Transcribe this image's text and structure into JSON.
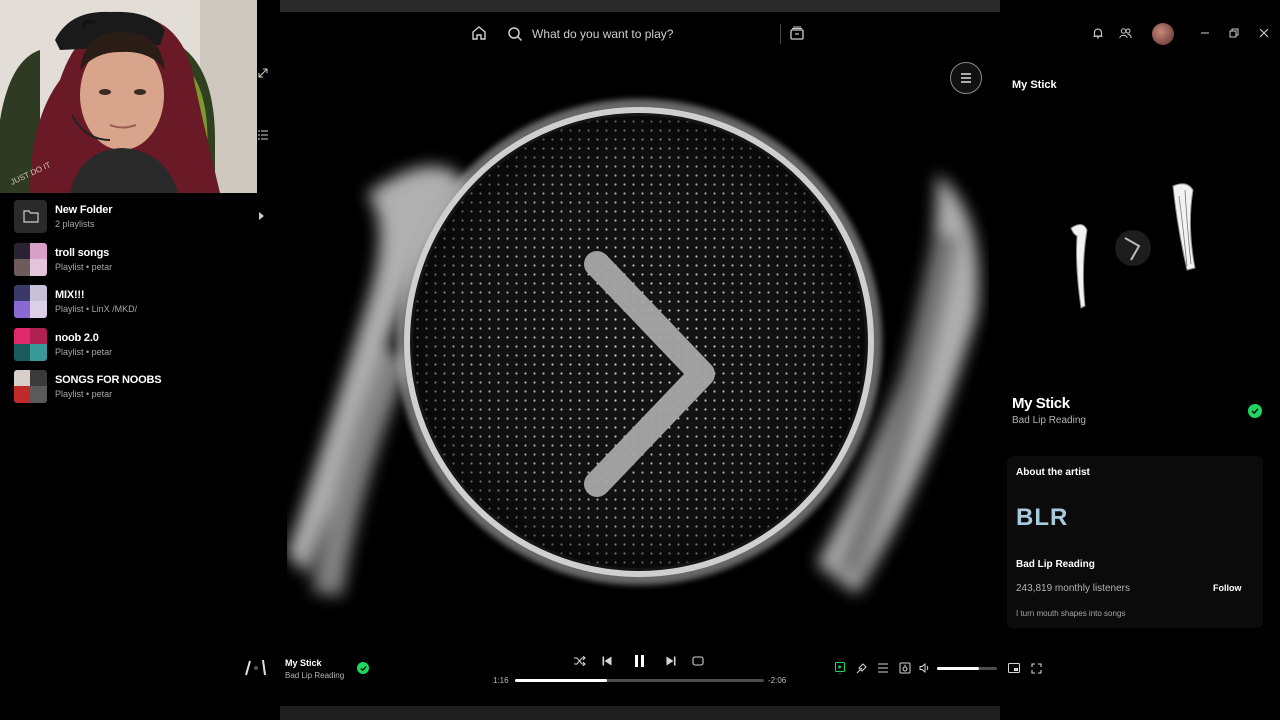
{
  "search": {
    "placeholder": "What do you want to play?"
  },
  "colors": {
    "accent": "#1ed760",
    "background": "#000000",
    "artist_logo": "#a9c9dc"
  },
  "library": {
    "items": [
      {
        "title": "New Folder",
        "subtitle": "2 playlists",
        "type": "folder",
        "icon": "folder-icon"
      },
      {
        "title": "troll songs",
        "subtitle": "Playlist • petar",
        "type": "playlist",
        "thumb_colors": [
          "#2a2233",
          "#d8a0c8",
          "#6e5c5c",
          "#e3c4da"
        ]
      },
      {
        "title": "MIX!!!",
        "subtitle": "Playlist • LinX /MKD/",
        "type": "playlist",
        "thumb_colors": [
          "#3a3a6a",
          "#c8c0d8",
          "#8a6ad0",
          "#dcd0e8"
        ]
      },
      {
        "title": "noob 2.0",
        "subtitle": "Playlist • petar",
        "type": "playlist",
        "thumb_colors": [
          "#e0286a",
          "#b02050",
          "#1a5a5a",
          "#3a9a9a"
        ]
      },
      {
        "title": "SONGS FOR NOOBS",
        "subtitle": "Playlist • petar",
        "type": "playlist",
        "thumb_colors": [
          "#d8d0c8",
          "#3a3a3a",
          "#c02a2a",
          "#5a5a5a"
        ]
      }
    ]
  },
  "right_panel": {
    "title": "My Stick",
    "song": "My Stick",
    "artist": "Bad Lip Reading",
    "about": {
      "heading": "About the artist",
      "logo_text": "BLR",
      "name": "Bad Lip Reading",
      "listeners": "243,819 monthly listeners",
      "follow_label": "Follow",
      "bio": "I turn mouth shapes into songs"
    }
  },
  "player": {
    "title": "My Stick",
    "artist": "Bad Lip Reading",
    "elapsed": "1:16",
    "remaining": "-2:06",
    "progress": 0.37,
    "volume": 0.7
  }
}
